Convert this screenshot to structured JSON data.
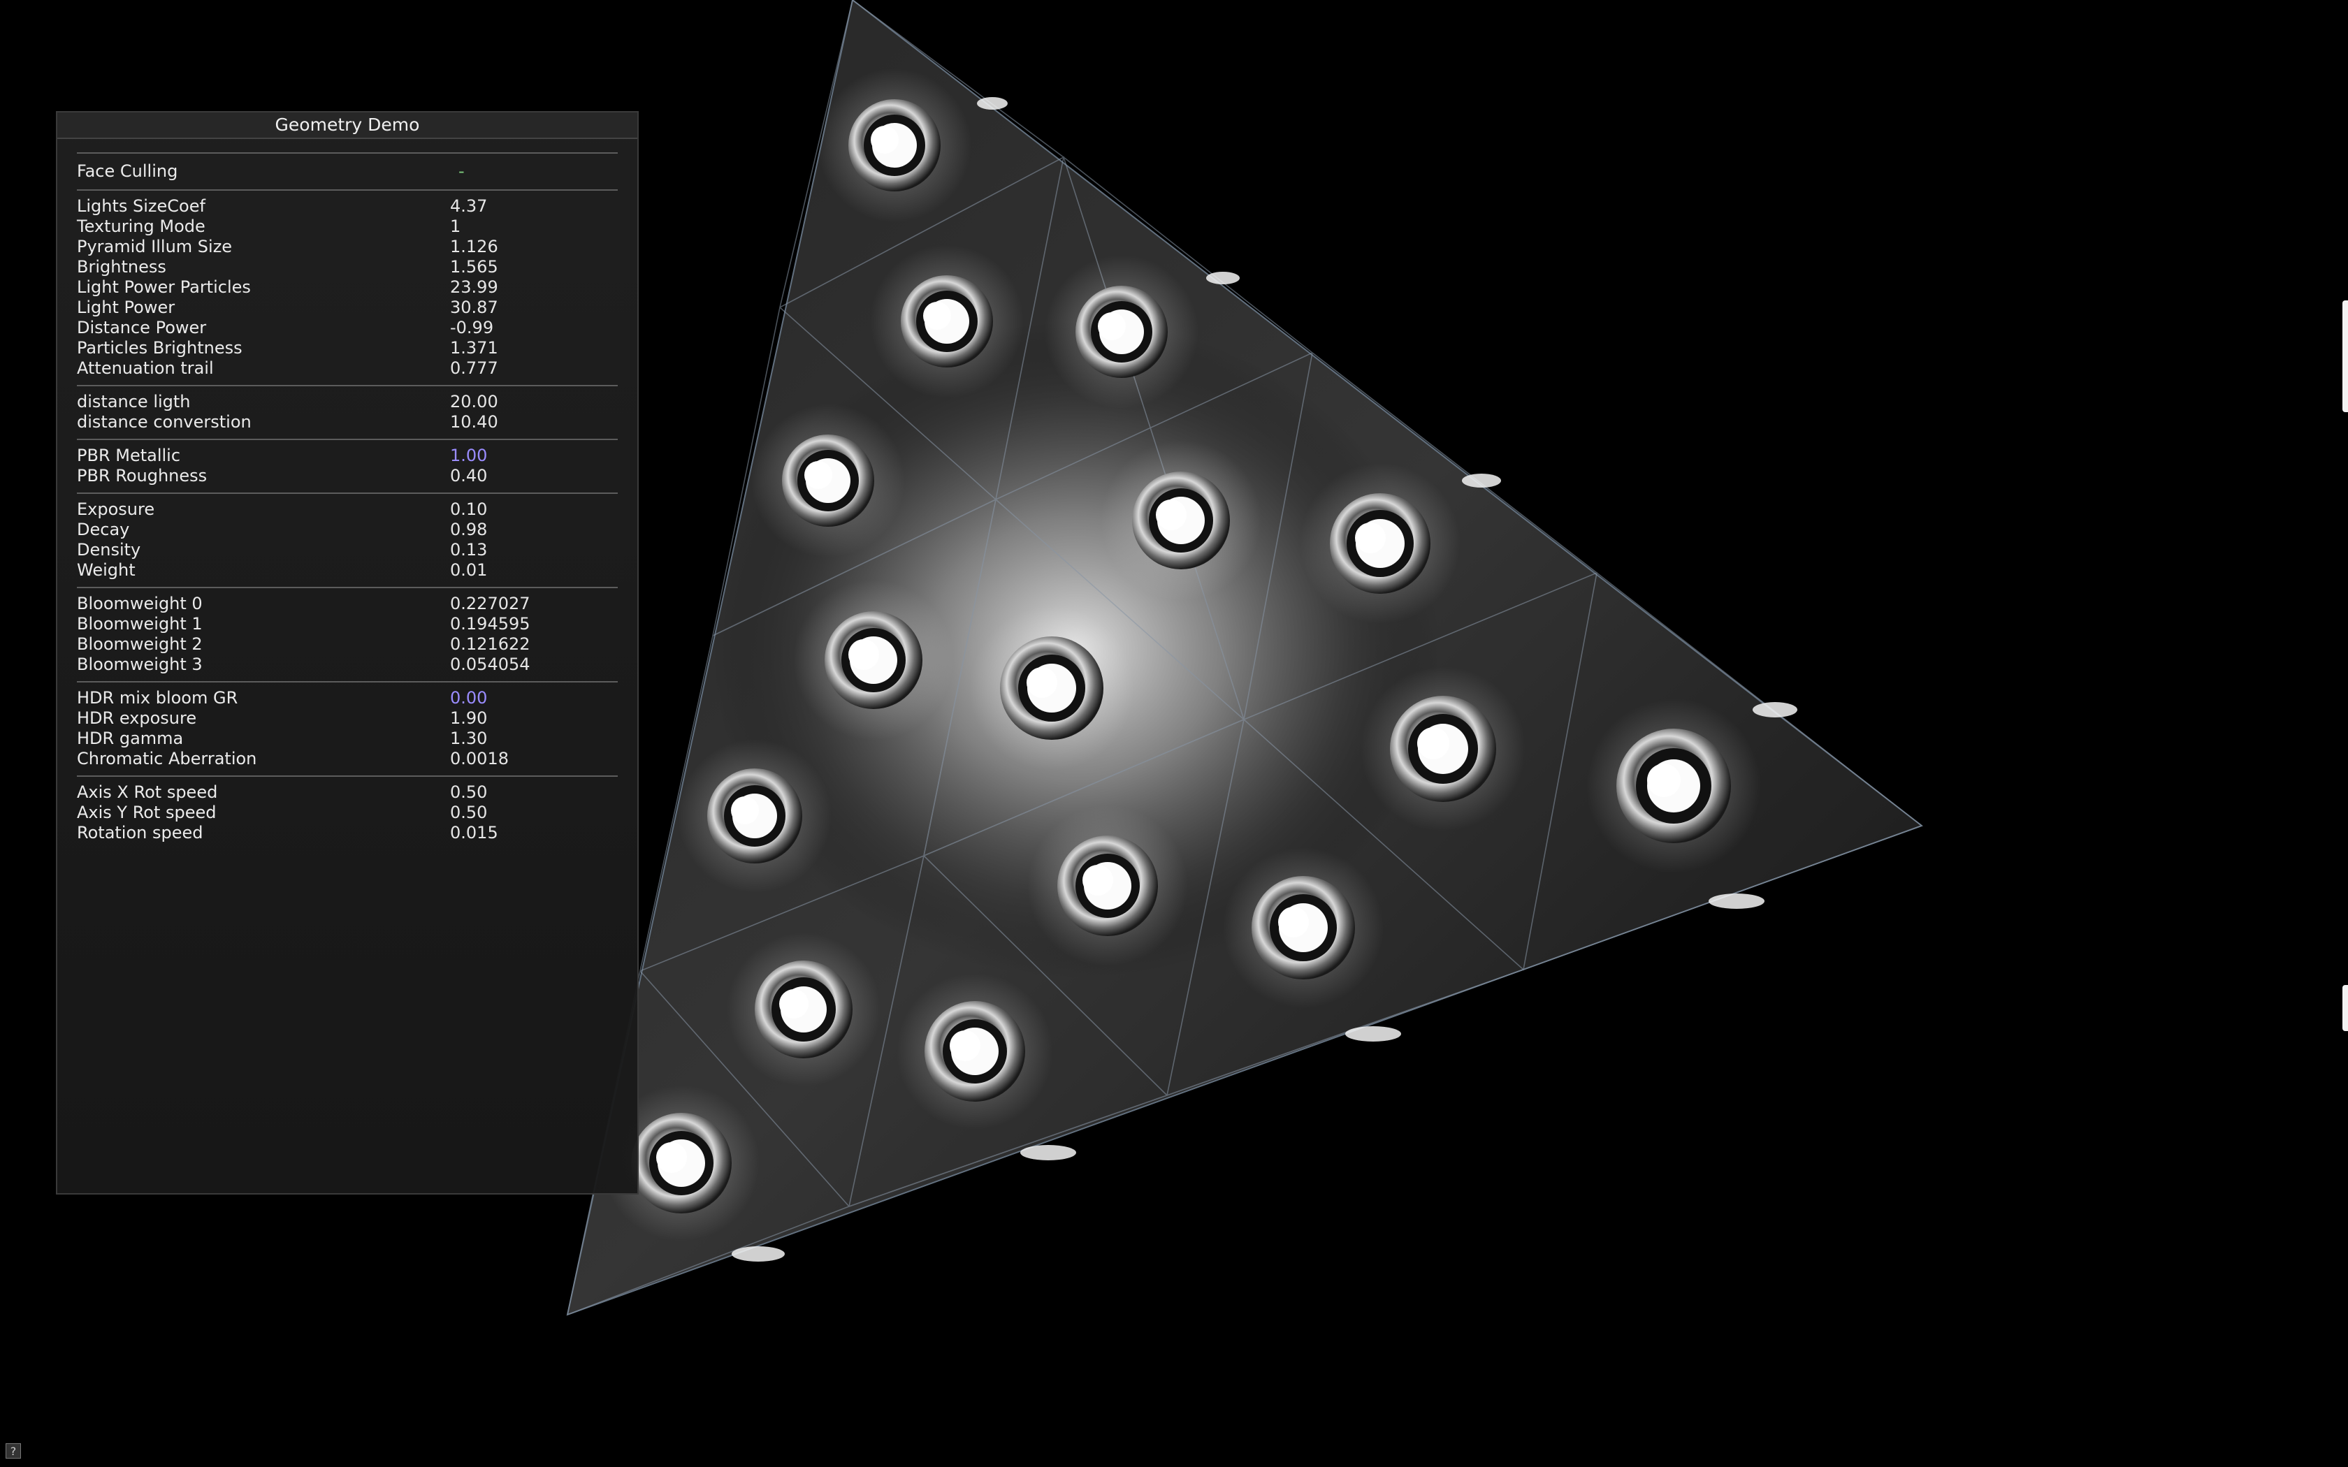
{
  "panel": {
    "title": "Geometry Demo",
    "groups": [
      [
        {
          "label": "Face Culling",
          "value": "-"
        }
      ],
      [
        {
          "label": "Lights SizeCoef",
          "value": "4.37"
        },
        {
          "label": "Texturing Mode",
          "value": "1"
        },
        {
          "label": "Pyramid Illum Size",
          "value": "1.126"
        },
        {
          "label": "Brightness",
          "value": "1.565"
        },
        {
          "label": "Light Power Particles",
          "value": "23.99"
        },
        {
          "label": "Light Power",
          "value": "30.87"
        },
        {
          "label": "Distance Power",
          "value": "-0.99"
        },
        {
          "label": "Particles Brightness",
          "value": "1.371"
        },
        {
          "label": "Attenuation trail",
          "value": "0.777"
        }
      ],
      [
        {
          "label": "distance ligth",
          "value": "20.00"
        },
        {
          "label": "distance converstion",
          "value": "10.40"
        }
      ],
      [
        {
          "label": "PBR Metallic",
          "value": "1.00"
        },
        {
          "label": "PBR Roughness",
          "value": "0.40"
        }
      ],
      [
        {
          "label": "Exposure",
          "value": "0.10"
        },
        {
          "label": "Decay",
          "value": "0.98"
        },
        {
          "label": "Density",
          "value": "0.13"
        },
        {
          "label": "Weight",
          "value": "0.01"
        }
      ],
      [
        {
          "label": "Bloomweight 0",
          "value": "0.227027"
        },
        {
          "label": "Bloomweight 1",
          "value": "0.194595"
        },
        {
          "label": "Bloomweight 2",
          "value": "0.121622"
        },
        {
          "label": "Bloomweight 3",
          "value": "0.054054"
        }
      ],
      [
        {
          "label": "HDR mix bloom GR",
          "value": "0.00"
        },
        {
          "label": "HDR exposure",
          "value": "1.90"
        },
        {
          "label": "HDR gamma",
          "value": "1.30"
        },
        {
          "label": "Chromatic Aberration",
          "value": "0.0018"
        }
      ],
      [
        {
          "label": "Axis X Rot speed",
          "value": "0.50"
        },
        {
          "label": "Axis Y Rot speed",
          "value": "0.50"
        },
        {
          "label": "Rotation speed",
          "value": "0.015"
        }
      ]
    ]
  },
  "help_badge": "?",
  "colors": {
    "background": "#000000",
    "panel_bg": "#1c1c1c",
    "accent_value": "#9a8cff",
    "culling_dash": "#7cc97c"
  }
}
